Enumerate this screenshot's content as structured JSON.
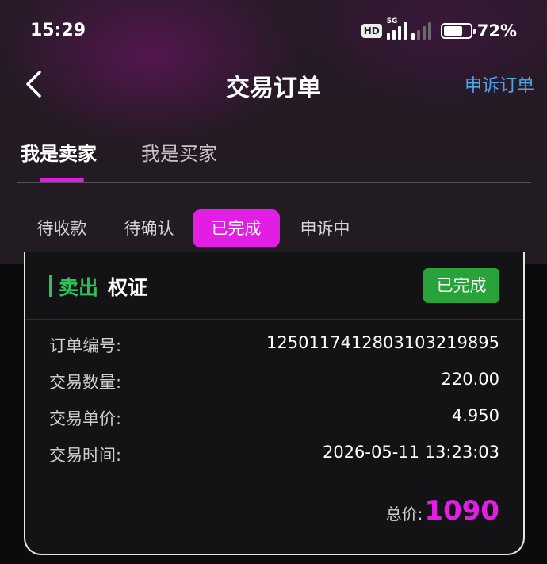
{
  "status_bar": {
    "time": "15:29",
    "hd": "HD",
    "network": "5G",
    "battery": "72%",
    "battery_level": 0.72
  },
  "nav": {
    "back_icon": "chevron-left-icon",
    "title": "交易订单",
    "appeal_link": "申诉订单"
  },
  "role_tabs": [
    {
      "label": "我是卖家",
      "active": true
    },
    {
      "label": "我是买家",
      "active": false
    }
  ],
  "status_tabs": [
    {
      "label": "待收款",
      "active": false
    },
    {
      "label": "待确认",
      "active": false
    },
    {
      "label": "已完成",
      "active": true
    },
    {
      "label": "申诉中",
      "active": false
    }
  ],
  "order": {
    "side": "卖出",
    "asset": "权证",
    "status": "已完成",
    "fields": [
      {
        "label": "订单编号:",
        "value": "1250117412803103219895"
      },
      {
        "label": "交易数量:",
        "value": "220.00"
      },
      {
        "label": "交易单价:",
        "value": "4.950"
      },
      {
        "label": "交易时间:",
        "value": "2026-05-11 13:23:03"
      }
    ],
    "total_label": "总价:",
    "total_value": "1090"
  },
  "colors": {
    "accent": "#e21ee4",
    "link": "#4ea6ea",
    "sell": "#2fc05a",
    "badge": "#27a33a"
  }
}
